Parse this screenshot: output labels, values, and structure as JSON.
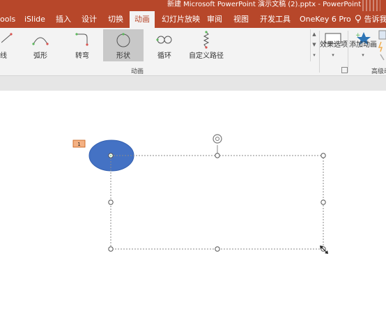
{
  "window": {
    "title": "新建 Microsoft PowerPoint 演示文稿 (2).pptx - PowerPoint"
  },
  "tabs": [
    {
      "label": "ools"
    },
    {
      "label": "iSlide"
    },
    {
      "label": "插入"
    },
    {
      "label": "设计"
    },
    {
      "label": "切换"
    },
    {
      "label": "动画"
    },
    {
      "label": "幻灯片放映"
    },
    {
      "label": "审阅"
    },
    {
      "label": "视图"
    },
    {
      "label": "开发工具"
    },
    {
      "label": "OneKey 6 Pro"
    },
    {
      "label": "告诉我"
    }
  ],
  "active_tab": "动画",
  "ribbon": {
    "effects": [
      {
        "label": "线"
      },
      {
        "label": "弧形"
      },
      {
        "label": "转弯"
      },
      {
        "label": "形状"
      },
      {
        "label": "循环"
      },
      {
        "label": "自定义路径"
      }
    ],
    "selected_effect": "形状",
    "group_label": "动画",
    "effect_options_label": "效果选项",
    "add_animation_label": "添加动画",
    "advanced_group_label": "高级动"
  },
  "slide": {
    "animation_badge": "1"
  },
  "colors": {
    "brand": "#b7472a",
    "ribbon_bg": "#f3f3f3",
    "oval_fill": "#4472c4",
    "badge_fill": "#f4b183"
  }
}
